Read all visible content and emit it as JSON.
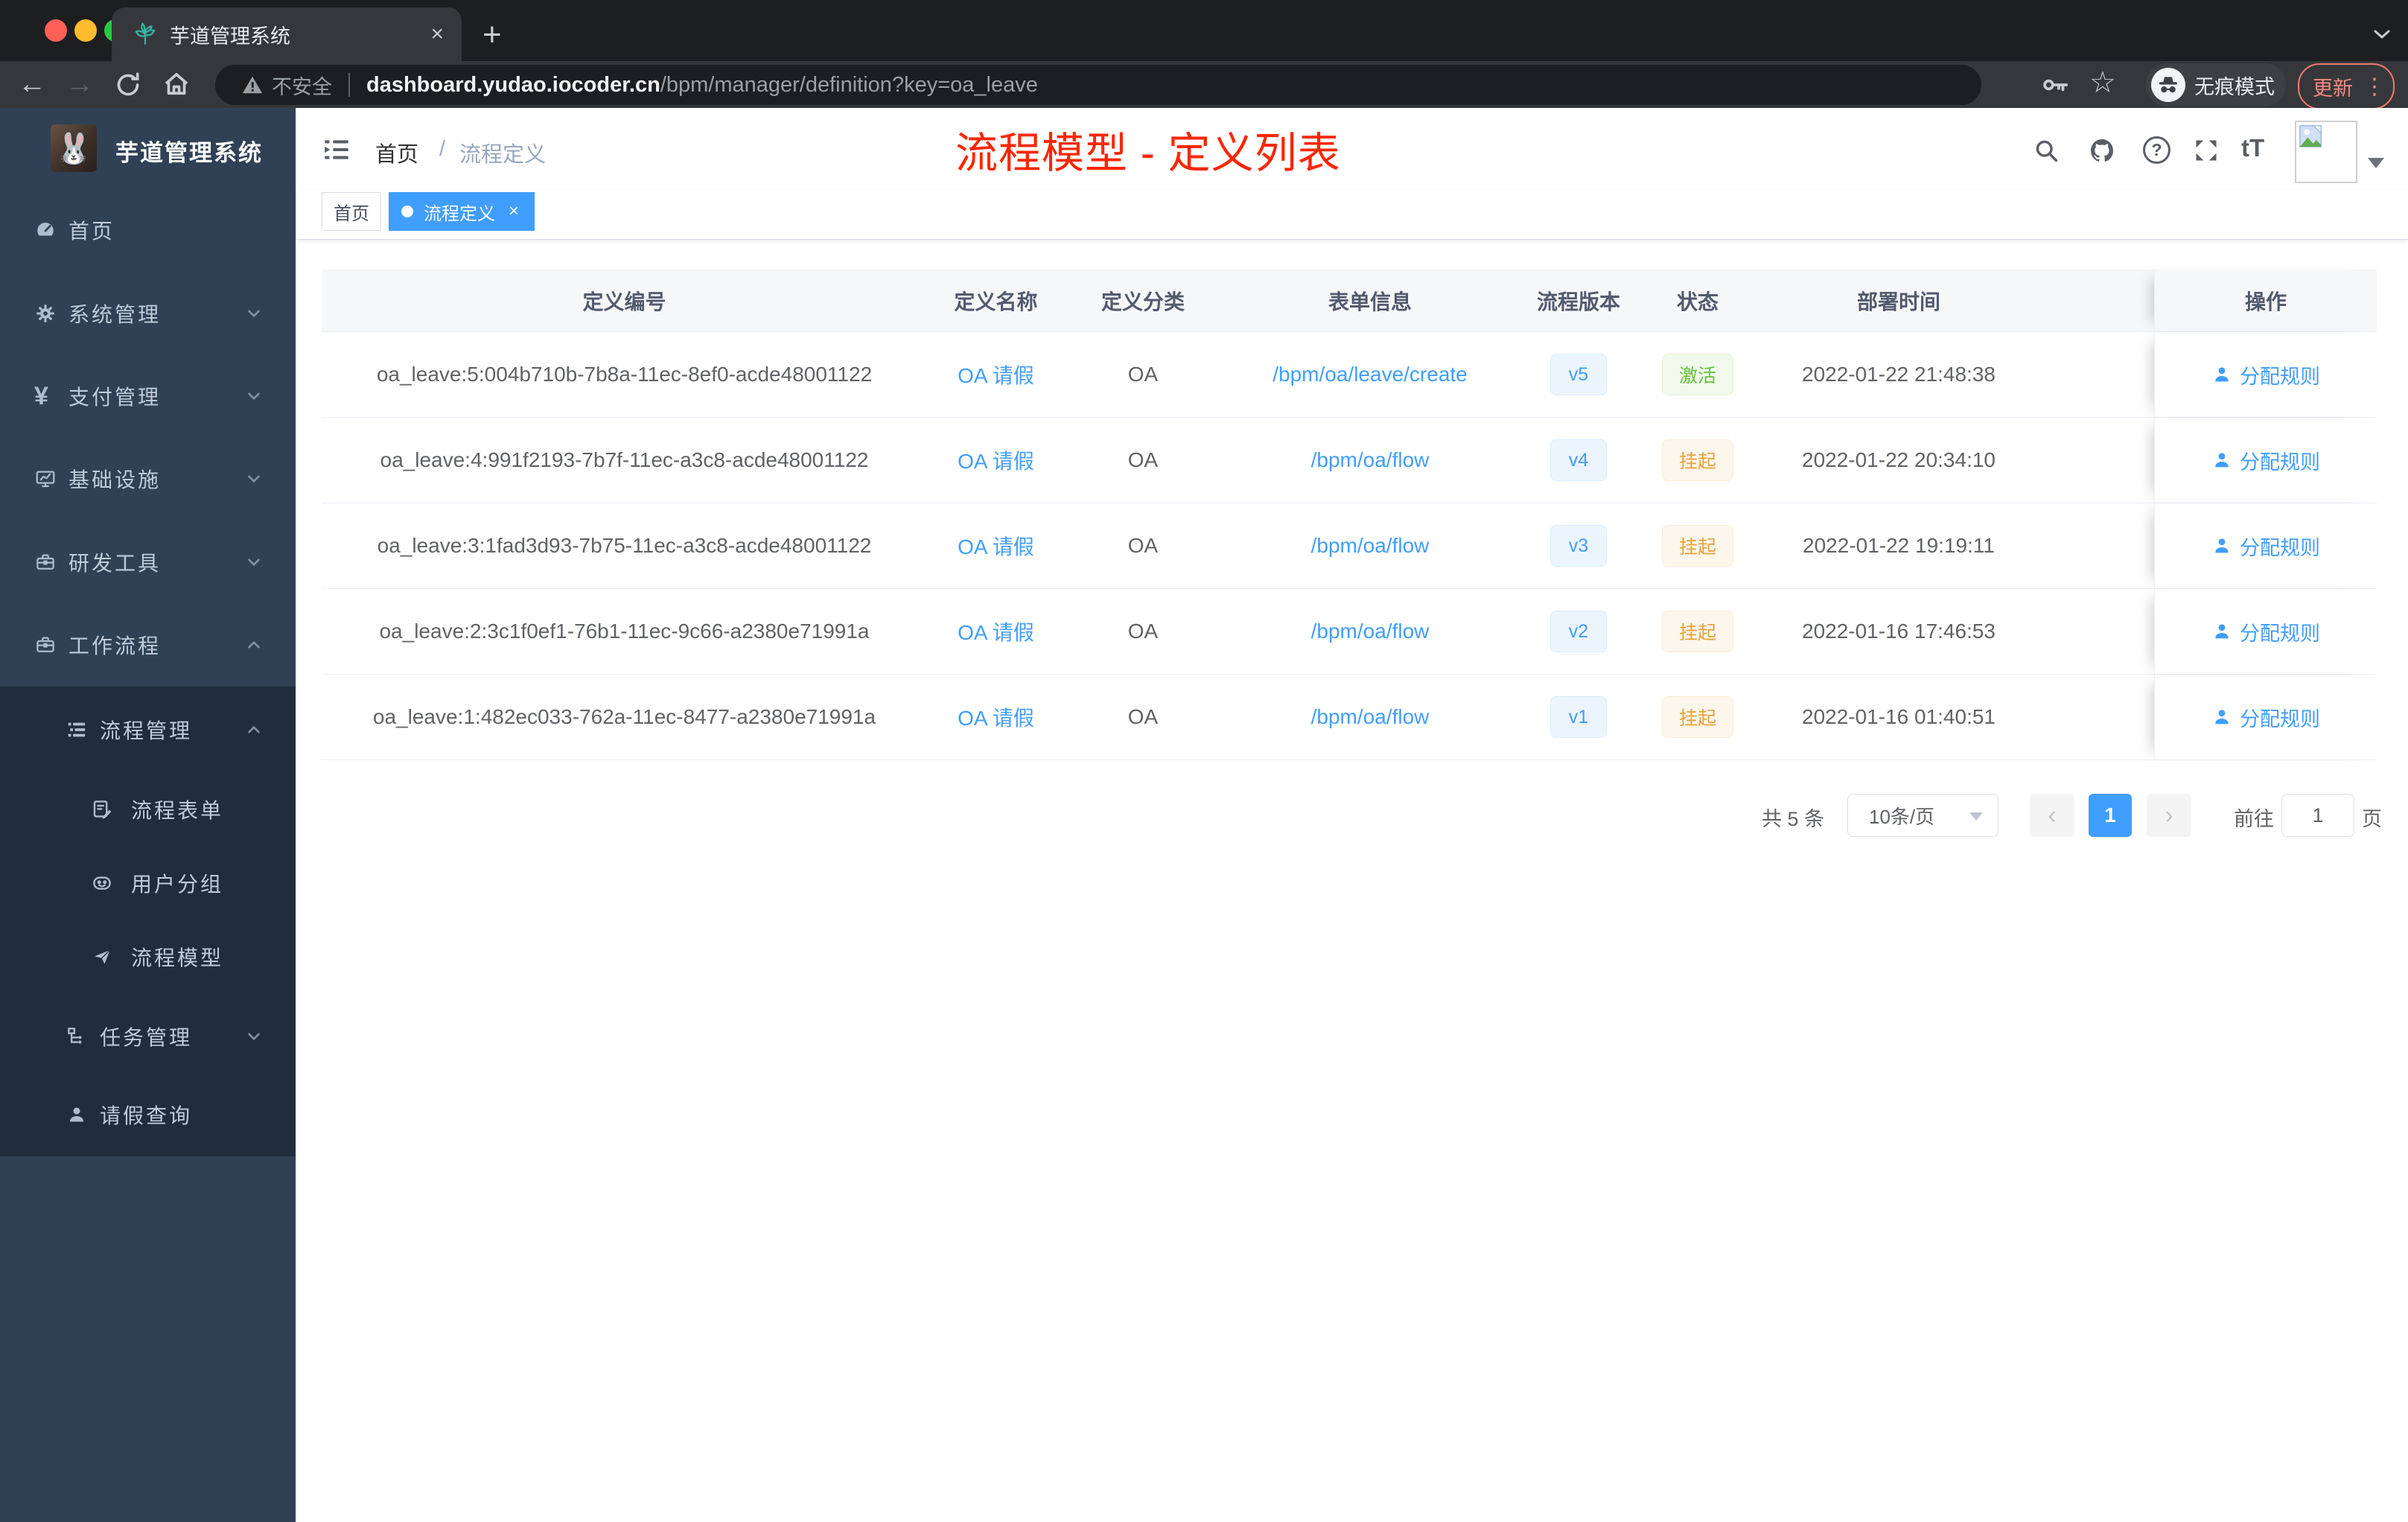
{
  "browser": {
    "tab_title": "芋道管理系统",
    "security_label": "不安全",
    "url_host": "dashboard.yudao.iocoder.cn",
    "url_path": "/bpm/manager/definition?key=oa_leave",
    "incognito_label": "无痕模式",
    "update_label": "更新"
  },
  "glyphs": {
    "close": "×",
    "plus": "+",
    "back": "←",
    "forward": "→",
    "star": "☆",
    "dots": "⋮",
    "prev": "‹",
    "next": "›",
    "question": "?",
    "font_size": "tT",
    "yen": "¥",
    "rabbit": "🐰"
  },
  "annotation": {
    "text": "流程模型 - 定义列表",
    "color": "#fc2602"
  },
  "sidebar": {
    "logo_title": "芋道管理系统",
    "items": [
      {
        "label": "首页"
      },
      {
        "label": "系统管理"
      },
      {
        "label": "支付管理"
      },
      {
        "label": "基础设施"
      },
      {
        "label": "研发工具"
      },
      {
        "label": "工作流程"
      },
      {
        "label": "流程管理"
      },
      {
        "label": "流程表单"
      },
      {
        "label": "用户分组"
      },
      {
        "label": "流程模型"
      },
      {
        "label": "任务管理"
      },
      {
        "label": "请假查询"
      }
    ]
  },
  "breadcrumb": {
    "home": "首页",
    "separator": "/",
    "current": "流程定义"
  },
  "tags": [
    {
      "label": "首页"
    },
    {
      "label": "流程定义"
    }
  ],
  "table": {
    "columns": [
      "定义编号",
      "定义名称",
      "定义分类",
      "表单信息",
      "流程版本",
      "状态",
      "部署时间",
      "操作"
    ],
    "rows": [
      {
        "id": "oa_leave:5:004b710b-7b8a-11ec-8ef0-acde48001122",
        "name": "OA 请假",
        "category": "OA",
        "form": "/bpm/oa/leave/create",
        "version": "v5",
        "status": "激活",
        "time": "2022-01-22 21:48:38",
        "action": "分配规则"
      },
      {
        "id": "oa_leave:4:991f2193-7b7f-11ec-a3c8-acde48001122",
        "name": "OA 请假",
        "category": "OA",
        "form": "/bpm/oa/flow",
        "version": "v4",
        "status": "挂起",
        "time": "2022-01-22 20:34:10",
        "action": "分配规则"
      },
      {
        "id": "oa_leave:3:1fad3d93-7b75-11ec-a3c8-acde48001122",
        "name": "OA 请假",
        "category": "OA",
        "form": "/bpm/oa/flow",
        "version": "v3",
        "status": "挂起",
        "time": "2022-01-22 19:19:11",
        "action": "分配规则"
      },
      {
        "id": "oa_leave:2:3c1f0ef1-76b1-11ec-9c66-a2380e71991a",
        "name": "OA 请假",
        "category": "OA",
        "form": "/bpm/oa/flow",
        "version": "v2",
        "status": "挂起",
        "time": "2022-01-16 17:46:53",
        "action": "分配规则"
      },
      {
        "id": "oa_leave:1:482ec033-762a-11ec-8477-a2380e71991a",
        "name": "OA 请假",
        "category": "OA",
        "form": "/bpm/oa/flow",
        "version": "v1",
        "status": "挂起",
        "time": "2022-01-16 01:40:51",
        "action": "分配规则"
      }
    ]
  },
  "pagination": {
    "total": "共 5 条",
    "page_size": "10条/页",
    "current_page": "1",
    "goto_label": "前往",
    "goto_value": "1",
    "page_label": "页"
  }
}
